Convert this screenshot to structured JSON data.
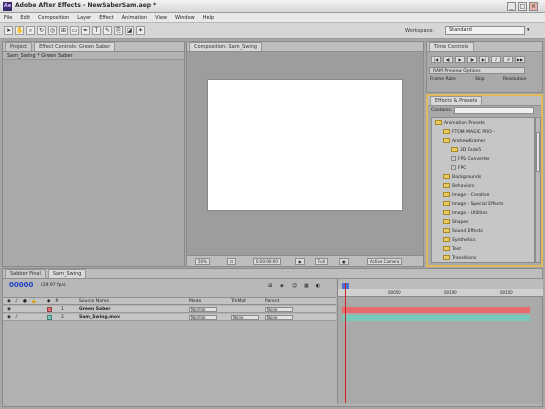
{
  "app": {
    "title": "Adobe After Effects - NewSaberSam.aep *"
  },
  "window_controls": {
    "minimize": "_",
    "maximize": "□",
    "close": "×"
  },
  "menu": [
    "File",
    "Edit",
    "Composition",
    "Layer",
    "Effect",
    "Animation",
    "View",
    "Window",
    "Help"
  ],
  "toolbar": {
    "workspace_label": "Workspace:",
    "workspace_value": "Standard"
  },
  "project_panel": {
    "tabs": [
      "Project",
      "Effect Controls: Green Saber"
    ],
    "subheader": "Sam_Swing * Green Saber"
  },
  "composition_panel": {
    "tab": "Composition: Sam_Swing",
    "footer": {
      "zoom": "50%",
      "time": "0:00:00:00",
      "resolution": "Full",
      "camera": "Active Camera"
    }
  },
  "time_controls": {
    "tab": "Time Controls",
    "ram_preview_label": "RAM Preview Options",
    "frame_rate": "Frame Rate",
    "skip": "Skip",
    "resolution": "Resolution"
  },
  "effects_presets": {
    "tab": "Effects & Presets",
    "contains_label": "Contains:",
    "tree": [
      {
        "label": "Animation Presets",
        "type": "folder",
        "indent": 0
      },
      {
        "label": "FTOM MAGIC PRO -",
        "type": "folder",
        "indent": 1
      },
      {
        "label": "AndrewKramer",
        "type": "folder",
        "indent": 1
      },
      {
        "label": "3D Fade5",
        "type": "folder",
        "indent": 2
      },
      {
        "label": "FPS Converter",
        "type": "preset",
        "indent": 2
      },
      {
        "label": "FPC",
        "type": "preset",
        "indent": 2
      },
      {
        "label": "Backgrounds",
        "type": "folder",
        "indent": 1
      },
      {
        "label": "Behaviors",
        "type": "folder",
        "indent": 1
      },
      {
        "label": "Image - Creative",
        "type": "folder",
        "indent": 1
      },
      {
        "label": "Image - Special Effects",
        "type": "folder",
        "indent": 1
      },
      {
        "label": "Image - Utilities",
        "type": "folder",
        "indent": 1
      },
      {
        "label": "Shapes",
        "type": "folder",
        "indent": 1
      },
      {
        "label": "Sound Effects",
        "type": "folder",
        "indent": 1
      },
      {
        "label": "Synthetics",
        "type": "folder",
        "indent": 1
      },
      {
        "label": "Text",
        "type": "folder",
        "indent": 1
      },
      {
        "label": "Transitions",
        "type": "folder",
        "indent": 1
      }
    ]
  },
  "timeline": {
    "tabs": [
      "Sabber Final",
      "Sam_Swing"
    ],
    "current_time": "00000",
    "fps": "(29.97 fps)",
    "columns": {
      "source_name": "Source Name",
      "mode": "Mode",
      "trkmat": "TrkMat",
      "parent": "Parent"
    },
    "layers": [
      {
        "num": "1",
        "name": "Green Saber",
        "mode": "Normal",
        "trkmat": "",
        "parent": "None"
      },
      {
        "num": "2",
        "name": "Sam_Swing.mov",
        "mode": "Normal",
        "trkmat": "None",
        "parent": "None"
      }
    ],
    "ruler_ticks": [
      "00050",
      "00100",
      "00150"
    ],
    "colors": {
      "layer1_bar": "#e86b6b",
      "layer2_bar": "#78c9b9",
      "playhead": "#d02020"
    }
  }
}
